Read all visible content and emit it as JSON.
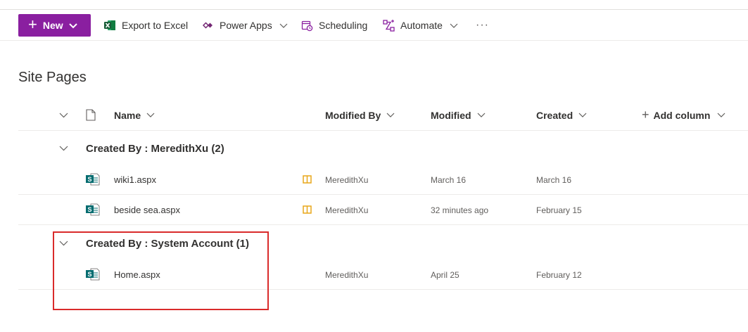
{
  "command_bar": {
    "new_label": "New",
    "export_label": "Export to Excel",
    "power_apps_label": "Power Apps",
    "scheduling_label": "Scheduling",
    "automate_label": "Automate",
    "more_label": "···",
    "new_button_color": "#8a1fa0"
  },
  "page": {
    "title": "Site Pages"
  },
  "columns": {
    "name": "Name",
    "modified_by": "Modified By",
    "modified": "Modified",
    "created": "Created",
    "add_column": "Add column"
  },
  "groups": [
    {
      "title": "Created By : MeredithXu (2)",
      "rows": [
        {
          "name": "wiki1.aspx",
          "modified_by": "MeredithXu",
          "modified": "March 16",
          "created": "March 16"
        },
        {
          "name": "beside sea.aspx",
          "modified_by": "MeredithXu",
          "modified": "32 minutes ago",
          "created": "February 15"
        }
      ]
    },
    {
      "title": "Created By : System Account (1)",
      "rows": [
        {
          "name": "Home.aspx",
          "modified_by": "MeredithXu",
          "modified": "April 25",
          "created": "February 12"
        }
      ]
    }
  ],
  "colors": {
    "highlight": "#d92b2b",
    "sharepoint_icon": "#036c70",
    "book_icon": "#e8a71a"
  }
}
